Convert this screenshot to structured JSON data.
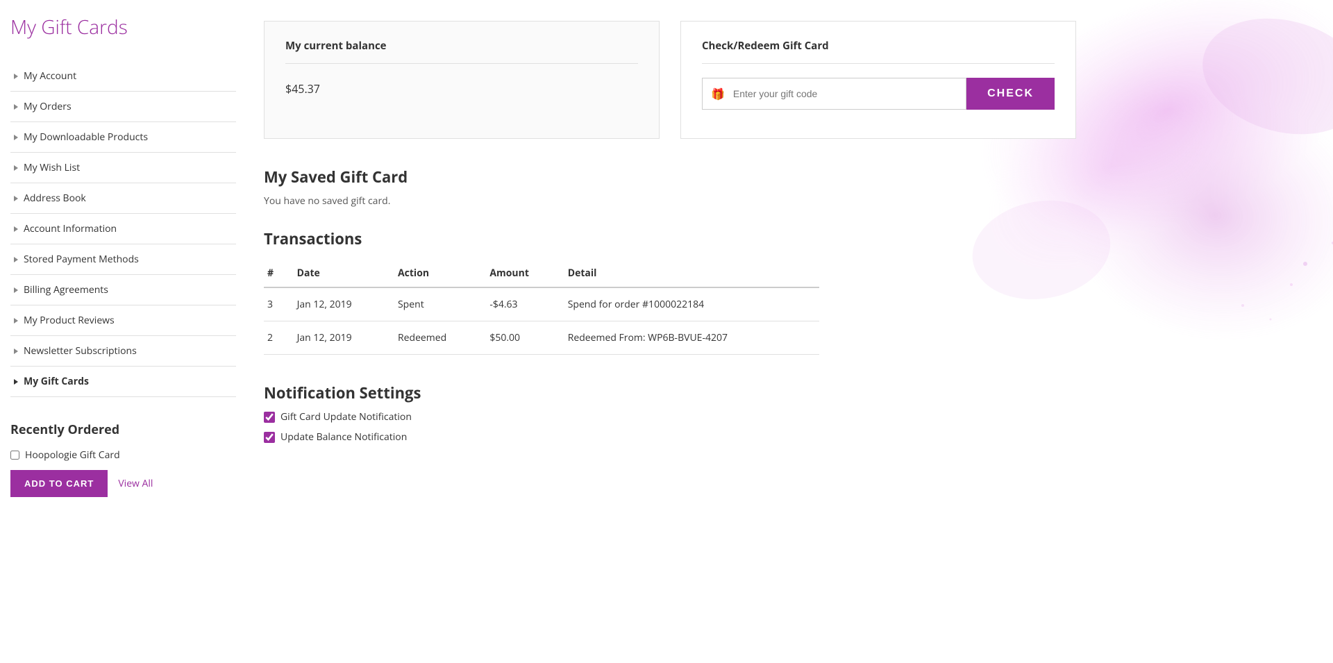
{
  "page": {
    "title": "My Gift Cards"
  },
  "sidebar": {
    "items": [
      {
        "id": "my-account",
        "label": "My Account",
        "active": false
      },
      {
        "id": "my-orders",
        "label": "My Orders",
        "active": false
      },
      {
        "id": "my-downloadable-products",
        "label": "My Downloadable Products",
        "active": false
      },
      {
        "id": "my-wish-list",
        "label": "My Wish List",
        "active": false
      },
      {
        "id": "address-book",
        "label": "Address Book",
        "active": false
      },
      {
        "id": "account-information",
        "label": "Account Information",
        "active": false
      },
      {
        "id": "stored-payment-methods",
        "label": "Stored Payment Methods",
        "active": false
      },
      {
        "id": "billing-agreements",
        "label": "Billing Agreements",
        "active": false
      },
      {
        "id": "my-product-reviews",
        "label": "My Product Reviews",
        "active": false
      },
      {
        "id": "newsletter-subscriptions",
        "label": "Newsletter Subscriptions",
        "active": false
      },
      {
        "id": "my-gift-cards",
        "label": "My Gift Cards",
        "active": true
      }
    ]
  },
  "recently_ordered": {
    "title": "Recently Ordered",
    "item": "Hoopologie Gift Card",
    "add_to_cart_label": "ADD TO CART",
    "view_all_label": "View All"
  },
  "balance_panel": {
    "title": "My current balance",
    "amount": "$45.37"
  },
  "redeem_panel": {
    "title": "Check/Redeem Gift Card",
    "input_placeholder": "Enter your gift code",
    "button_label": "CHECK"
  },
  "saved_gift_card": {
    "title": "My Saved Gift Card",
    "message": "You have no saved gift card."
  },
  "transactions": {
    "title": "Transactions",
    "columns": [
      "#",
      "Date",
      "Action",
      "Amount",
      "Detail"
    ],
    "rows": [
      {
        "num": "3",
        "date": "Jan 12, 2019",
        "action": "Spent",
        "amount": "-$4.63",
        "detail": "Spend for order #1000022184"
      },
      {
        "num": "2",
        "date": "Jan 12, 2019",
        "action": "Redeemed",
        "amount": "$50.00",
        "detail": "Redeemed From: WP6B-BVUE-4207"
      }
    ]
  },
  "notification_settings": {
    "title": "Notification Settings",
    "items": [
      {
        "id": "gift-card-update",
        "label": "Gift Card Update Notification",
        "checked": true
      },
      {
        "id": "update-balance",
        "label": "Update Balance Notification",
        "checked": true
      }
    ]
  },
  "colors": {
    "accent": "#9b2fa0"
  }
}
